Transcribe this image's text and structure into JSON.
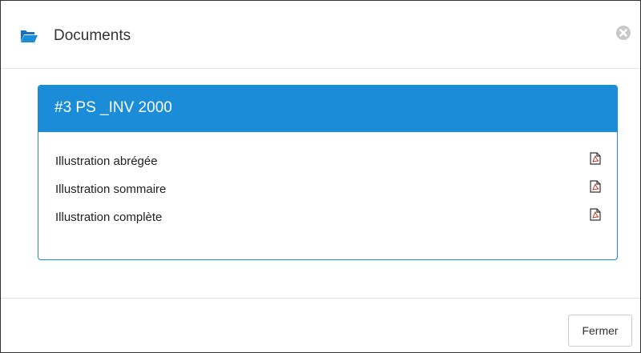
{
  "modal": {
    "title": "Documents",
    "folder_icon": "folder-open-icon",
    "close_icon": "close-circle-icon"
  },
  "panel": {
    "title": "#3 PS _INV 2000",
    "accent_color": "#1a8cd8"
  },
  "documents": [
    {
      "label": "Illustration abrégée",
      "icon": "pdf-icon"
    },
    {
      "label": "Illustration sommaire",
      "icon": "pdf-icon"
    },
    {
      "label": "Illustration complète",
      "icon": "pdf-icon"
    }
  ],
  "footer": {
    "close_label": "Fermer"
  }
}
